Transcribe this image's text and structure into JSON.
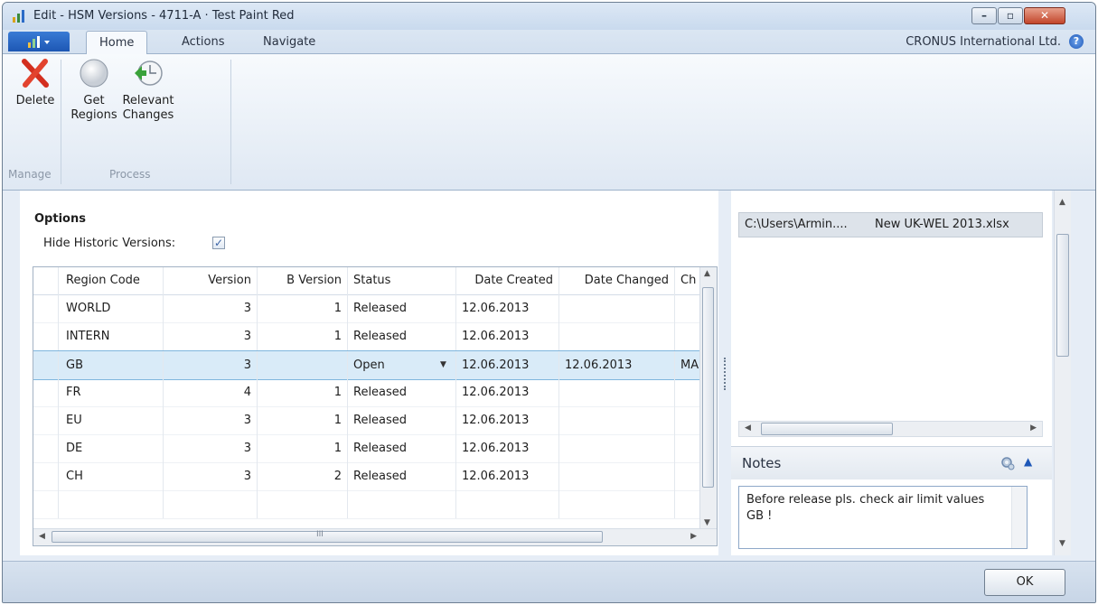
{
  "window": {
    "title": "Edit - HSM Versions - 4711-A · Test Paint Red",
    "min_glyph": "–",
    "max_glyph": "▫",
    "close_glyph": "✕"
  },
  "ribbon_tabs": [
    "Home",
    "Actions",
    "Navigate"
  ],
  "company": "CRONUS International Ltd.",
  "help_glyph": "?",
  "ribbon": {
    "delete": "Delete",
    "get_regions": [
      "Get",
      "Regions"
    ],
    "relevant_changes": [
      "Relevant",
      "Changes"
    ],
    "group_manage": "Manage",
    "group_process": "Process"
  },
  "options": {
    "title": "Options",
    "hide_label": "Hide Historic Versions:",
    "hide_checked": "✓"
  },
  "grid": {
    "headers": [
      "Region Code",
      "Version",
      "B Version",
      "Status",
      "Date Created",
      "Date Changed",
      "Ch"
    ],
    "rows": [
      [
        "WORLD",
        "3",
        "1",
        "Released",
        "12.06.2013",
        "",
        ""
      ],
      [
        "INTERN",
        "3",
        "1",
        "Released",
        "12.06.2013",
        "",
        ""
      ],
      [
        "GB",
        "3",
        "",
        "Open",
        "12.06.2013",
        "12.06.2013",
        "MA"
      ],
      [
        "FR",
        "4",
        "1",
        "Released",
        "12.06.2013",
        "",
        ""
      ],
      [
        "EU",
        "3",
        "1",
        "Released",
        "12.06.2013",
        "",
        ""
      ],
      [
        "DE",
        "3",
        "1",
        "Released",
        "12.06.2013",
        "",
        ""
      ],
      [
        "CH",
        "3",
        "2",
        "Released",
        "12.06.2013",
        "",
        ""
      ]
    ],
    "selected_row": 2,
    "scroll_glyph": "III"
  },
  "factbox": {
    "path": "C:\\Users\\Armin....",
    "file": "New UK-WEL 2013.xlsx"
  },
  "notes": {
    "title": "Notes",
    "text": "Before release pls. check air limit values GB !"
  },
  "footer": {
    "ok_label": "OK"
  }
}
